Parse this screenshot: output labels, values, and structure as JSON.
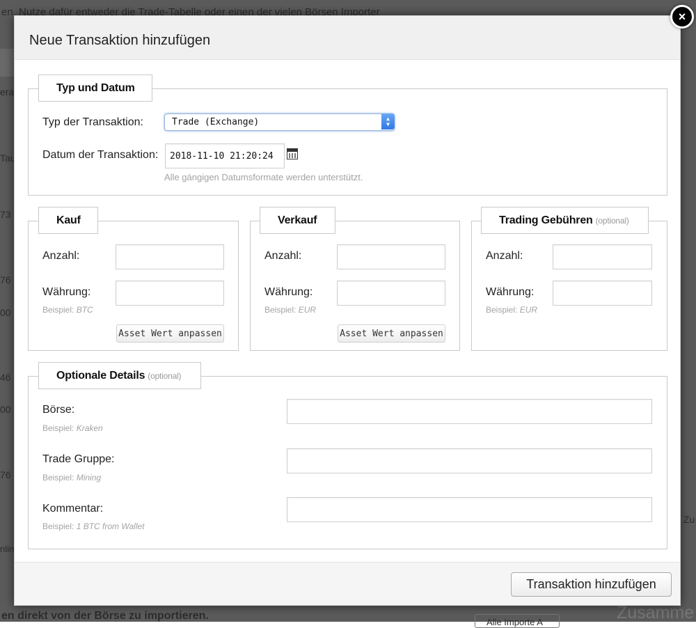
{
  "background": {
    "top_text": "en. Nutze dafür entweder die Trade-Tabelle oder einen der vielen Börsen Importer",
    "bottom_text": "en direkt von der Börse zu importieren.",
    "bottom_right_text": "Zusamme",
    "bottom_right_button": "Alle Importe A",
    "right_edge_text": "Zu",
    "left_fragments": [
      "era",
      "Tau",
      "73",
      "76",
      "00",
      "46",
      "00",
      "76",
      "nline"
    ]
  },
  "modal": {
    "title": "Neue Transaktion hinzufügen",
    "close_label": "×",
    "submit_label": "Transaktion hinzufügen"
  },
  "typ_datum": {
    "legend": "Typ und Datum",
    "type_label": "Typ der Transaktion:",
    "type_value": "Trade (Exchange)",
    "date_label": "Datum der Transaktion:",
    "date_value": "2018-11-10 21:20:24",
    "date_hint": "Alle gängigen Datumsformate werden unterstützt."
  },
  "kauf": {
    "legend": "Kauf",
    "anzahl_label": "Anzahl:",
    "waehrung_label": "Währung:",
    "hint_prefix": "Beispiel:",
    "hint_example": "BTC",
    "button": "Asset Wert anpassen"
  },
  "verkauf": {
    "legend": "Verkauf",
    "anzahl_label": "Anzahl:",
    "waehrung_label": "Währung:",
    "hint_prefix": "Beispiel:",
    "hint_example": "EUR",
    "button": "Asset Wert anpassen"
  },
  "gebuehren": {
    "legend": "Trading Gebühren",
    "legend_optional": "(optional)",
    "anzahl_label": "Anzahl:",
    "waehrung_label": "Währung:",
    "hint_prefix": "Beispiel:",
    "hint_example": "EUR"
  },
  "details": {
    "legend": "Optionale Details",
    "legend_optional": "(optional)",
    "boerse_label": "Börse:",
    "boerse_hint_prefix": "Beispiel:",
    "boerse_hint_example": "Kraken",
    "gruppe_label": "Trade Gruppe:",
    "gruppe_hint_prefix": "Beispiel:",
    "gruppe_hint_example": "Mining",
    "kommentar_label": "Kommentar:",
    "kommentar_hint_prefix": "Beispiel:",
    "kommentar_hint_example": "1 BTC from Wallet"
  }
}
